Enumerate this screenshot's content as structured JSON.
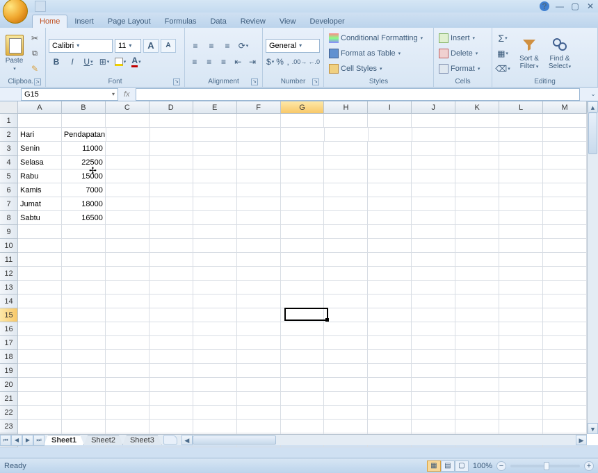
{
  "titlebar": {
    "help_tip": "?"
  },
  "tabs": [
    "Home",
    "Insert",
    "Page Layout",
    "Formulas",
    "Data",
    "Review",
    "View",
    "Developer"
  ],
  "active_tab": 0,
  "ribbon": {
    "clipboard": {
      "label": "Clipboa...",
      "paste": "Paste"
    },
    "font": {
      "label": "Font",
      "name": "Calibri",
      "size": "11",
      "increase": "A",
      "decrease": "A",
      "bold": "B",
      "italic": "I",
      "underline": "U"
    },
    "alignment": {
      "label": "Alignment"
    },
    "number": {
      "label": "Number",
      "format": "General",
      "currency": "$",
      "percent": "%",
      "comma": ","
    },
    "styles": {
      "label": "Styles",
      "cond": "Conditional Formatting",
      "table": "Format as Table",
      "cell": "Cell Styles"
    },
    "cells": {
      "label": "Cells",
      "insert": "Insert",
      "delete": "Delete",
      "format": "Format"
    },
    "editing": {
      "label": "Editing",
      "sort": "Sort & Filter",
      "find": "Find & Select",
      "sigma": "Σ"
    }
  },
  "namebox": "G15",
  "fx_label": "fx",
  "columns": [
    "A",
    "B",
    "C",
    "D",
    "E",
    "F",
    "G",
    "H",
    "I",
    "J",
    "K",
    "L",
    "M"
  ],
  "selected_col": 6,
  "rows": 24,
  "selected_row": 15,
  "active": {
    "col": 6,
    "row": 15
  },
  "data": {
    "2": {
      "A": "Hari",
      "B": "Pendapatan"
    },
    "3": {
      "A": "Senin",
      "B": "11000"
    },
    "4": {
      "A": "Selasa",
      "B": "22500"
    },
    "5": {
      "A": "Rabu",
      "B": "15000"
    },
    "6": {
      "A": "Kamis",
      "B": "7000"
    },
    "7": {
      "A": "Jumat",
      "B": "18000"
    },
    "8": {
      "A": "Sabtu",
      "B": "16500"
    }
  },
  "cursor_overlay": {
    "row": 5,
    "col": 1,
    "glyph": "✢"
  },
  "sheets": [
    "Sheet1",
    "Sheet2",
    "Sheet3"
  ],
  "active_sheet": 0,
  "status": {
    "ready": "Ready",
    "zoom": "100%"
  }
}
